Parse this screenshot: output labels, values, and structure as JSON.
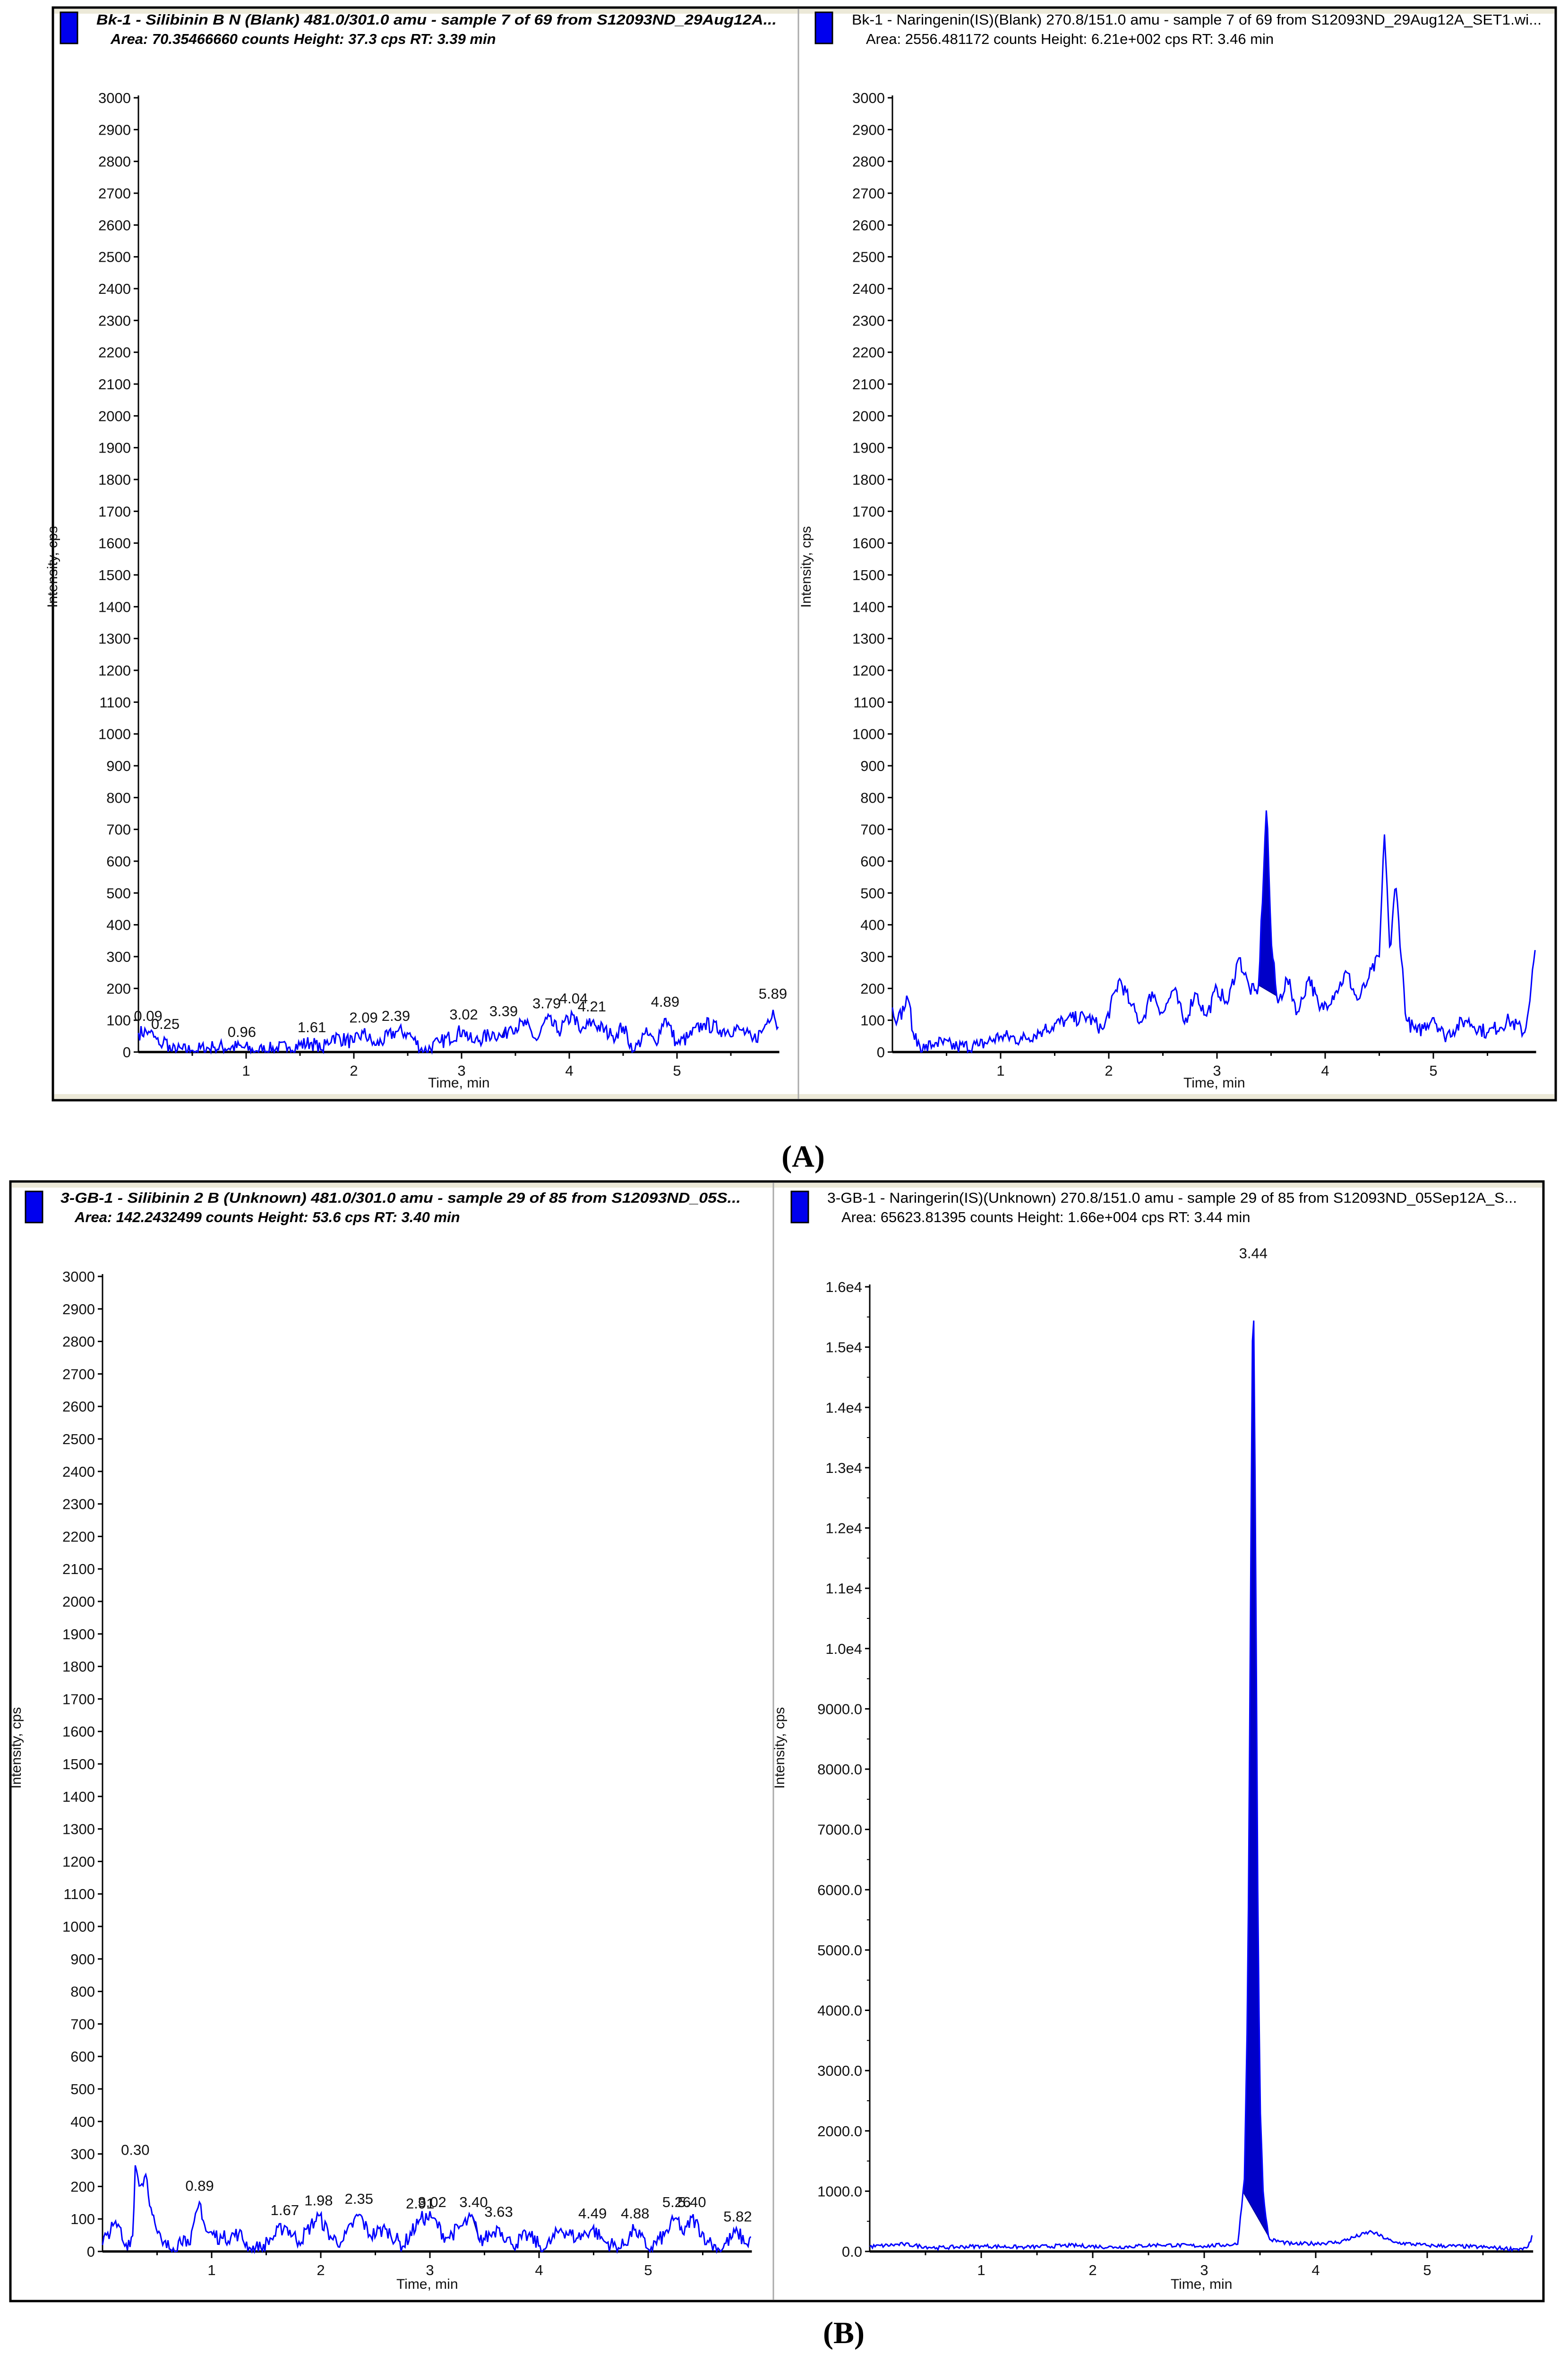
{
  "panel_labels": [
    "(A)",
    "(B)"
  ],
  "colors": {
    "trace": "#0000ff",
    "legend_square": "#0000ee",
    "header_strip": "#ece9d8",
    "frame": "#000000"
  },
  "chart_data": [
    {
      "type": "line",
      "header_line1": "Bk-1 - Silibinin B N (Blank) 481.0/301.0 amu - sample 7 of 69 from S12093ND_29Aug12A...",
      "header_line2": "Area: 70.35466660 counts  Height: 37.3 cps  RT: 3.39 min",
      "xlabel": "Time, min",
      "ylabel": "Intensity, cps",
      "xlim": [
        0,
        5.95
      ],
      "ylim": [
        0,
        3000
      ],
      "xticks": [
        1,
        2,
        3,
        4,
        5
      ],
      "yticks": [
        0,
        100,
        200,
        300,
        400,
        500,
        600,
        700,
        800,
        900,
        1000,
        1100,
        1200,
        1300,
        1400,
        1500,
        1600,
        1700,
        1800,
        1900,
        2000,
        2100,
        2200,
        2300,
        2400,
        2500,
        2600,
        2700,
        2800,
        2900,
        3000
      ],
      "ytick_labels": [
        "0",
        "100",
        "200",
        "300",
        "400",
        "500",
        "600",
        "700",
        "800",
        "900",
        "1000",
        "1100",
        "1200",
        "1300",
        "1400",
        "1500",
        "1600",
        "1700",
        "1800",
        "1900",
        "2000",
        "2100",
        "2200",
        "2300",
        "2400",
        "2500",
        "2600",
        "2700",
        "2800",
        "2900",
        "3000"
      ],
      "integrated_peak": [
        3.37,
        3.42
      ],
      "trace": [
        [
          0,
          60
        ],
        [
          0.1,
          65
        ],
        [
          0.2,
          20
        ],
        [
          0.25,
          40
        ],
        [
          0.3,
          5
        ],
        [
          0.5,
          5
        ],
        [
          0.7,
          15
        ],
        [
          0.96,
          15
        ],
        [
          1.1,
          3
        ],
        [
          1.4,
          15
        ],
        [
          1.61,
          30
        ],
        [
          1.7,
          5
        ],
        [
          1.8,
          50
        ],
        [
          2.0,
          30
        ],
        [
          2.09,
          60
        ],
        [
          2.2,
          20
        ],
        [
          2.39,
          65
        ],
        [
          2.5,
          60
        ],
        [
          2.65,
          2
        ],
        [
          2.8,
          30
        ],
        [
          3.02,
          70
        ],
        [
          3.1,
          30
        ],
        [
          3.3,
          60
        ],
        [
          3.39,
          45
        ],
        [
          3.45,
          80
        ],
        [
          3.6,
          85
        ],
        [
          3.7,
          35
        ],
        [
          3.79,
          105
        ],
        [
          3.9,
          65
        ],
        [
          4.04,
          120
        ],
        [
          4.1,
          60
        ],
        [
          4.21,
          95
        ],
        [
          4.4,
          50
        ],
        [
          4.5,
          80
        ],
        [
          4.6,
          0
        ],
        [
          4.7,
          60
        ],
        [
          4.8,
          30
        ],
        [
          4.89,
          110
        ],
        [
          5.0,
          25
        ],
        [
          5.1,
          45
        ],
        [
          5.25,
          90
        ],
        [
          5.4,
          70
        ],
        [
          5.6,
          70
        ],
        [
          5.7,
          35
        ],
        [
          5.8,
          70
        ],
        [
          5.89,
          135
        ],
        [
          5.95,
          60
        ]
      ],
      "peak_labels": [
        {
          "t": 0.09,
          "v": 65,
          "label": "0.09"
        },
        {
          "t": 0.25,
          "v": 40,
          "label": "0.25"
        },
        {
          "t": 0.96,
          "v": 15,
          "label": "0.96"
        },
        {
          "t": 1.61,
          "v": 30,
          "label": "1.61"
        },
        {
          "t": 2.09,
          "v": 60,
          "label": "2.09"
        },
        {
          "t": 2.39,
          "v": 65,
          "label": "2.39"
        },
        {
          "t": 3.02,
          "v": 70,
          "label": "3.02"
        },
        {
          "t": 3.39,
          "v": 80,
          "label": "3.39"
        },
        {
          "t": 3.79,
          "v": 105,
          "label": "3.79"
        },
        {
          "t": 4.04,
          "v": 120,
          "label": "4.04"
        },
        {
          "t": 4.21,
          "v": 95,
          "label": "4.21"
        },
        {
          "t": 4.89,
          "v": 110,
          "label": "4.89"
        },
        {
          "t": 5.89,
          "v": 135,
          "label": "5.89"
        }
      ]
    },
    {
      "type": "line",
      "header_line1": "Bk-1 - Naringenin(IS)(Blank) 270.8/151.0 amu - sample 7 of 69 from S12093ND_29Aug12A_SET1.wi...",
      "header_line2": "Area: 2556.481172 counts  Height: 6.21e+002 cps  RT: 3.46 min",
      "xlabel": "Time, min",
      "ylabel": "Intensity, cps",
      "xlim": [
        0,
        5.95
      ],
      "ylim": [
        0,
        3000
      ],
      "xticks": [
        1,
        2,
        3,
        4,
        5
      ],
      "yticks": [
        0,
        100,
        200,
        300,
        400,
        500,
        600,
        700,
        800,
        900,
        1000,
        1100,
        1200,
        1300,
        1400,
        1500,
        1600,
        1700,
        1800,
        1900,
        2000,
        2100,
        2200,
        2300,
        2400,
        2500,
        2600,
        2700,
        2800,
        2900,
        3000
      ],
      "ytick_labels": [
        "0",
        "100",
        "200",
        "300",
        "400",
        "500",
        "600",
        "700",
        "800",
        "900",
        "1000",
        "1100",
        "1200",
        "1300",
        "1400",
        "1500",
        "1600",
        "1700",
        "1800",
        "1900",
        "2000",
        "2100",
        "2200",
        "2300",
        "2400",
        "2500",
        "2600",
        "2700",
        "2800",
        "2900",
        "3000"
      ],
      "integrated_peak": [
        3.38,
        3.56
      ],
      "trace": [
        [
          0,
          140
        ],
        [
          0.05,
          100
        ],
        [
          0.15,
          170
        ],
        [
          0.2,
          40
        ],
        [
          0.3,
          10
        ],
        [
          0.4,
          30
        ],
        [
          0.6,
          15
        ],
        [
          0.8,
          20
        ],
        [
          1.0,
          50
        ],
        [
          1.2,
          40
        ],
        [
          1.4,
          70
        ],
        [
          1.6,
          100
        ],
        [
          1.8,
          110
        ],
        [
          1.95,
          70
        ],
        [
          2.1,
          230
        ],
        [
          2.2,
          150
        ],
        [
          2.3,
          90
        ],
        [
          2.4,
          190
        ],
        [
          2.5,
          120
        ],
        [
          2.6,
          200
        ],
        [
          2.7,
          90
        ],
        [
          2.8,
          190
        ],
        [
          2.9,
          110
        ],
        [
          3.0,
          200
        ],
        [
          3.1,
          150
        ],
        [
          3.2,
          300
        ],
        [
          3.3,
          200
        ],
        [
          3.38,
          180
        ],
        [
          3.46,
          790
        ],
        [
          3.5,
          350
        ],
        [
          3.56,
          150
        ],
        [
          3.65,
          230
        ],
        [
          3.75,
          120
        ],
        [
          3.85,
          240
        ],
        [
          3.95,
          130
        ],
        [
          4.1,
          190
        ],
        [
          4.2,
          250
        ],
        [
          4.3,
          160
        ],
        [
          4.4,
          230
        ],
        [
          4.5,
          300
        ],
        [
          4.55,
          700
        ],
        [
          4.6,
          300
        ],
        [
          4.65,
          540
        ],
        [
          4.75,
          100
        ],
        [
          4.85,
          60
        ],
        [
          5.0,
          110
        ],
        [
          5.1,
          50
        ],
        [
          5.3,
          100
        ],
        [
          5.5,
          60
        ],
        [
          5.7,
          100
        ],
        [
          5.85,
          60
        ],
        [
          5.95,
          340
        ]
      ],
      "peak_labels": []
    },
    {
      "type": "line",
      "header_line1": "3-GB-1 - Silibinin 2 B (Unknown) 481.0/301.0 amu - sample 29 of 85 from S12093ND_05S...",
      "header_line2": "Area: 142.2432499 counts  Height: 53.6 cps  RT: 3.40 min",
      "xlabel": "Time, min",
      "ylabel": "Intensity, cps",
      "xlim": [
        0,
        5.95
      ],
      "ylim": [
        0,
        3000
      ],
      "xticks": [
        1,
        2,
        3,
        4,
        5
      ],
      "yticks": [
        0,
        100,
        200,
        300,
        400,
        500,
        600,
        700,
        800,
        900,
        1000,
        1100,
        1200,
        1300,
        1400,
        1500,
        1600,
        1700,
        1800,
        1900,
        2000,
        2100,
        2200,
        2300,
        2400,
        2500,
        2600,
        2700,
        2800,
        2900,
        3000
      ],
      "ytick_labels": [
        "0",
        "100",
        "200",
        "300",
        "400",
        "500",
        "600",
        "700",
        "800",
        "900",
        "1000",
        "1100",
        "1200",
        "1300",
        "1400",
        "1500",
        "1600",
        "1700",
        "1800",
        "1900",
        "2000",
        "2100",
        "2200",
        "2300",
        "2400",
        "2500",
        "2600",
        "2700",
        "2800",
        "2900",
        "3000"
      ],
      "integrated_peak": [
        3.38,
        3.46
      ],
      "trace": [
        [
          0,
          20
        ],
        [
          0.05,
          60
        ],
        [
          0.15,
          85
        ],
        [
          0.2,
          15
        ],
        [
          0.28,
          50
        ],
        [
          0.3,
          265
        ],
        [
          0.35,
          200
        ],
        [
          0.4,
          240
        ],
        [
          0.45,
          120
        ],
        [
          0.5,
          60
        ],
        [
          0.55,
          20
        ],
        [
          0.65,
          10
        ],
        [
          0.75,
          50
        ],
        [
          0.8,
          15
        ],
        [
          0.89,
          155
        ],
        [
          0.95,
          60
        ],
        [
          1.1,
          40
        ],
        [
          1.25,
          55
        ],
        [
          1.35,
          10
        ],
        [
          1.45,
          10
        ],
        [
          1.55,
          40
        ],
        [
          1.67,
          80
        ],
        [
          1.8,
          30
        ],
        [
          1.98,
          110
        ],
        [
          2.1,
          40
        ],
        [
          2.2,
          30
        ],
        [
          2.35,
          115
        ],
        [
          2.45,
          50
        ],
        [
          2.6,
          70
        ],
        [
          2.75,
          15
        ],
        [
          2.91,
          100
        ],
        [
          3.02,
          105
        ],
        [
          3.15,
          40
        ],
        [
          3.3,
          80
        ],
        [
          3.4,
          105
        ],
        [
          3.45,
          30
        ],
        [
          3.55,
          50
        ],
        [
          3.63,
          75
        ],
        [
          3.75,
          20
        ],
        [
          3.9,
          50
        ],
        [
          4.05,
          5
        ],
        [
          4.2,
          70
        ],
        [
          4.35,
          40
        ],
        [
          4.49,
          70
        ],
        [
          4.6,
          30
        ],
        [
          4.75,
          10
        ],
        [
          4.88,
          70
        ],
        [
          5.0,
          5
        ],
        [
          5.15,
          50
        ],
        [
          5.26,
          105
        ],
        [
          5.33,
          50
        ],
        [
          5.4,
          105
        ],
        [
          5.55,
          30
        ],
        [
          5.65,
          5
        ],
        [
          5.82,
          60
        ],
        [
          5.9,
          20
        ],
        [
          5.95,
          50
        ]
      ],
      "peak_labels": [
        {
          "t": 0.3,
          "v": 265,
          "label": "0.30"
        },
        {
          "t": 0.89,
          "v": 155,
          "label": "0.89"
        },
        {
          "t": 1.67,
          "v": 80,
          "label": "1.67"
        },
        {
          "t": 1.98,
          "v": 110,
          "label": "1.98"
        },
        {
          "t": 2.35,
          "v": 115,
          "label": "2.35"
        },
        {
          "t": 2.91,
          "v": 100,
          "label": "2.91"
        },
        {
          "t": 3.02,
          "v": 105,
          "label": "3.02"
        },
        {
          "t": 3.4,
          "v": 105,
          "label": "3.40"
        },
        {
          "t": 3.63,
          "v": 75,
          "label": "3.63"
        },
        {
          "t": 4.49,
          "v": 70,
          "label": "4.49"
        },
        {
          "t": 4.88,
          "v": 70,
          "label": "4.88"
        },
        {
          "t": 5.26,
          "v": 105,
          "label": "5.26"
        },
        {
          "t": 5.4,
          "v": 105,
          "label": "5.40"
        },
        {
          "t": 5.82,
          "v": 60,
          "label": "5.82"
        }
      ]
    },
    {
      "type": "line",
      "header_line1": "3-GB-1 - Naringerin(IS)(Unknown) 270.8/151.0 amu - sample 29 of 85 from S12093ND_05Sep12A_S...",
      "header_line2": "Area: 65623.81395 counts  Height: 1.66e+004 cps  RT: 3.44 min",
      "xlabel": "Time, min",
      "ylabel": "Intensity, cps",
      "xlim": [
        0,
        5.95
      ],
      "ylim": [
        0,
        16000
      ],
      "xticks": [
        1,
        2,
        3,
        4,
        5
      ],
      "yticks": [
        0,
        1000,
        2000,
        3000,
        4000,
        5000,
        6000,
        7000,
        8000,
        9000,
        10000,
        11000,
        12000,
        13000,
        14000,
        15000,
        16000
      ],
      "ytick_labels": [
        "0.0",
        "1000.0",
        "2000.0",
        "3000.0",
        "4000.0",
        "5000.0",
        "6000.0",
        "7000.0",
        "8000.0",
        "9000.0",
        "1.0e4",
        "1.1e4",
        "1.2e4",
        "1.3e4",
        "1.4e4",
        "1.5e4",
        "1.6e4"
      ],
      "integrated_peak": [
        3.34,
        3.58
      ],
      "trace": [
        [
          0,
          80
        ],
        [
          0.3,
          120
        ],
        [
          0.6,
          60
        ],
        [
          1.0,
          90
        ],
        [
          1.4,
          70
        ],
        [
          1.8,
          100
        ],
        [
          2.2,
          70
        ],
        [
          2.6,
          110
        ],
        [
          3.0,
          90
        ],
        [
          3.3,
          120
        ],
        [
          3.36,
          1200
        ],
        [
          3.39,
          4200
        ],
        [
          3.41,
          9200
        ],
        [
          3.43,
          14800
        ],
        [
          3.44,
          16300
        ],
        [
          3.46,
          12000
        ],
        [
          3.48,
          6000
        ],
        [
          3.5,
          2500
        ],
        [
          3.53,
          900
        ],
        [
          3.58,
          200
        ],
        [
          3.8,
          120
        ],
        [
          4.2,
          150
        ],
        [
          4.5,
          330
        ],
        [
          4.7,
          150
        ],
        [
          5.0,
          100
        ],
        [
          5.4,
          80
        ],
        [
          5.8,
          40
        ],
        [
          5.9,
          60
        ],
        [
          5.95,
          280
        ]
      ],
      "peak_labels": [
        {
          "t": 3.44,
          "v": 16300,
          "label": "3.44"
        }
      ]
    }
  ]
}
